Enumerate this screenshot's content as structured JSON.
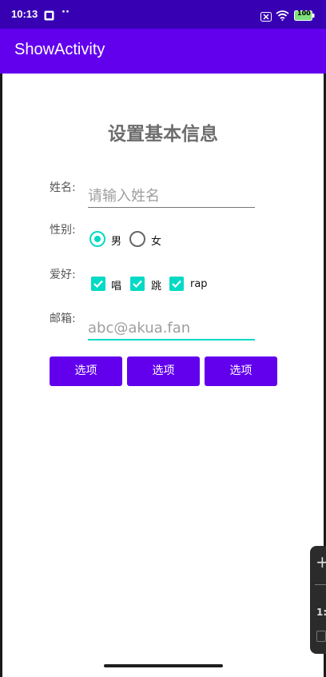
{
  "status_bar": {
    "time": "10:13",
    "dots": "··",
    "battery": "100",
    "icons": [
      "notification-app-icon",
      "close-box-icon",
      "wifi-icon",
      "battery-icon"
    ]
  },
  "app_bar": {
    "title": "ShowActivity"
  },
  "form": {
    "heading": "设置基本信息",
    "name_label": "姓名:",
    "name_placeholder": "请输入姓名",
    "gender_label": "性别:",
    "gender_male": "男",
    "gender_female": "女",
    "gender_selected": "男",
    "hobby_label": "爱好:",
    "hobby_options": [
      "唱",
      "跳",
      "rap"
    ],
    "hobby_checked": [
      "唱",
      "跳",
      "rap"
    ],
    "email_label": "邮箱:",
    "email_placeholder": "abc@akua.fan",
    "buttons": [
      "选项",
      "选项",
      "选项"
    ]
  },
  "floating_tool": {
    "plus": "+",
    "text": "1:"
  },
  "colors": {
    "status_bar": "#3700b3",
    "app_bar": "#6200ee",
    "accent": "#03dac5",
    "button": "#6200ee"
  }
}
